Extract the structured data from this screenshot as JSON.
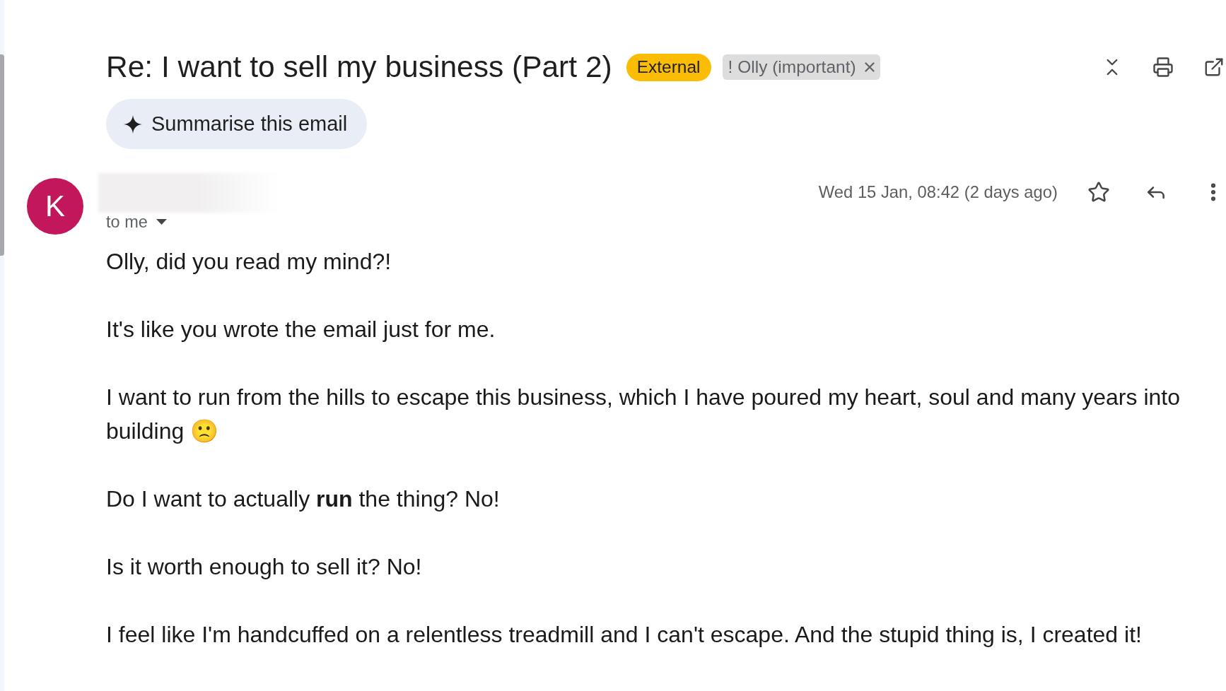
{
  "message": {
    "subject": "Re: I want to sell my business (Part 2)",
    "labels": [
      {
        "kind": "badge",
        "text": "External",
        "color": "#fbbc04",
        "removable": false
      },
      {
        "kind": "chip",
        "text": "! Olly (important)",
        "color": "#dddddd",
        "removable": true
      }
    ],
    "summarise_button": "Summarise this email",
    "sender": {
      "avatar_letter": "K",
      "name_redacted": true,
      "recipient": "to me",
      "date": "Wed 15 Jan, 08:42 (2 days ago)",
      "starred": false
    },
    "body": [
      "Olly, did you read my mind?!",
      "It's like you wrote the email just for me.",
      "I want to run from the hills to escape this business, which I have poured my heart, soul and many years into building 🙁",
      "Do I want to actually **run** the thing? No!",
      "Is it worth enough to sell it? No!",
      "I feel like I'm handcuffed on a relentless treadmill and I can't escape. And the stupid thing is, I created it!"
    ]
  }
}
